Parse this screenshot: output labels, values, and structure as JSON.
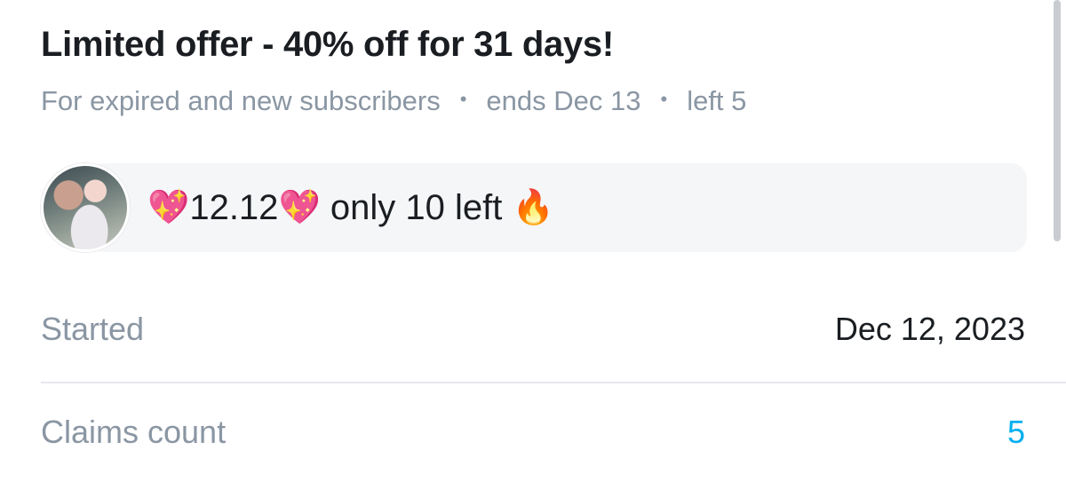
{
  "offer": {
    "title": "Limited offer - 40% off for 31 days!",
    "audience": "For expired and new subscribers",
    "ends": "ends Dec 13",
    "left": "left 5",
    "separator": "•"
  },
  "message": {
    "emoji_start": "💖",
    "text_part1": "12.12 ",
    "emoji_mid": "💖",
    "text_part2": " only 10 left ",
    "emoji_end": "🔥"
  },
  "details": {
    "started_label": "Started",
    "started_value": "Dec 12, 2023",
    "claims_label": "Claims count",
    "claims_value": "5"
  },
  "colors": {
    "accent": "#00aff0",
    "muted": "#8a96a3",
    "text": "#1a1d21",
    "bubble_bg": "#f5f6f8"
  }
}
